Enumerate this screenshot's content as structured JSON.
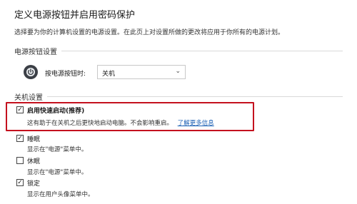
{
  "page": {
    "title": "定义电源按钮并启用密码保护",
    "description": "选择要为你的计算机设置的电源设置。在此页上对设置所做的更改将应用于你所有的电源计划。"
  },
  "power_button_section": {
    "heading": "电源按钮设置",
    "row_label": "按电源按钮时:",
    "selected_value": "关机"
  },
  "shutdown_section": {
    "heading": "关机设置",
    "options": [
      {
        "label": "启用快速启动(推荐)",
        "desc": "这有助于在关机之后更快地启动电脑。不会影响重启。",
        "link": "了解更多信息",
        "checked": true
      },
      {
        "label": "睡眠",
        "desc": "显示在\"电源\"菜单中。",
        "checked": true
      },
      {
        "label": "休眠",
        "desc": "显示在\"电源\"菜单中。",
        "checked": false
      },
      {
        "label": "锁定",
        "desc": "显示在用户头像菜单中。",
        "checked": true
      }
    ]
  },
  "colors": {
    "highlight_border": "#c4111e",
    "link": "#1a5fb4"
  }
}
